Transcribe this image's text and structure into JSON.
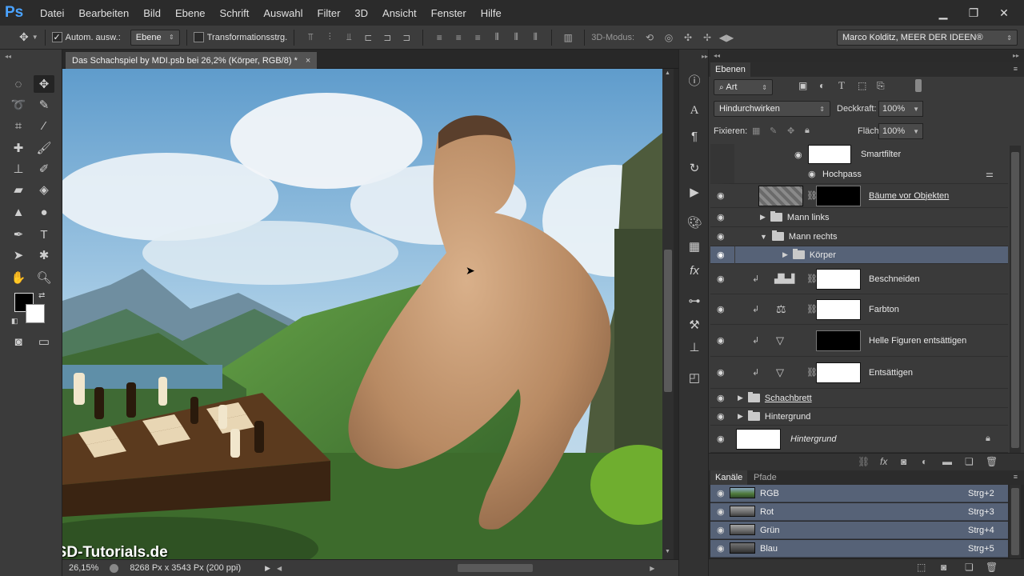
{
  "app": {
    "logo": "Ps"
  },
  "menu": [
    "Datei",
    "Bearbeiten",
    "Bild",
    "Ebene",
    "Schrift",
    "Auswahl",
    "Filter",
    "3D",
    "Ansicht",
    "Fenster",
    "Hilfe"
  ],
  "window_controls": [
    "minimize-icon",
    "restore-icon",
    "close-icon"
  ],
  "options": {
    "auto_select_label": "Autom. ausw.:",
    "auto_select_checked": true,
    "auto_select_value": "Ebene",
    "transform_label": "Transformationsstrg.",
    "transform_checked": false,
    "mode3d_label": "3D-Modus:",
    "workspace": "Marco Kolditz, MEER DER IDEEN®"
  },
  "document": {
    "tab_title": "Das Schachspiel by MDI.psb bei 26,2% (Körper, RGB/8) *",
    "close": "×"
  },
  "status": {
    "zoom": "26,15%",
    "doc_size": "8268 Px x 3543 Px (200 ppi)"
  },
  "watermark": "PSD-Tutorials.de",
  "layers_panel": {
    "tab": "Ebenen",
    "filter_kind": "Art",
    "blend_mode": "Hindurchwirken",
    "opacity_label": "Deckkraft:",
    "opacity_value": "100%",
    "lock_label": "Fixieren:",
    "fill_label": "Fläche:",
    "fill_value": "100%",
    "layers": [
      {
        "name": "Smartfilter"
      },
      {
        "name": "Hochpass"
      },
      {
        "name": "Bäume vor Objekten"
      },
      {
        "name": "Mann links"
      },
      {
        "name": "Mann rechts"
      },
      {
        "name": "Körper"
      },
      {
        "name": "Beschneiden"
      },
      {
        "name": "Farbton"
      },
      {
        "name": "Helle Figuren entsättigen"
      },
      {
        "name": "Entsättigen"
      },
      {
        "name": "Schachbrett"
      },
      {
        "name": "Hintergrund"
      },
      {
        "name": "Hintergrund"
      }
    ]
  },
  "channels_panel": {
    "tabs": [
      "Kanäle",
      "Pfade"
    ],
    "channels": [
      {
        "name": "RGB",
        "shortcut": "Strg+2"
      },
      {
        "name": "Rot",
        "shortcut": "Strg+3"
      },
      {
        "name": "Grün",
        "shortcut": "Strg+4"
      },
      {
        "name": "Blau",
        "shortcut": "Strg+5"
      }
    ]
  },
  "colors": {
    "accent": "#4aa3ff",
    "selection": "#566277",
    "panel": "#3a3a3a"
  }
}
